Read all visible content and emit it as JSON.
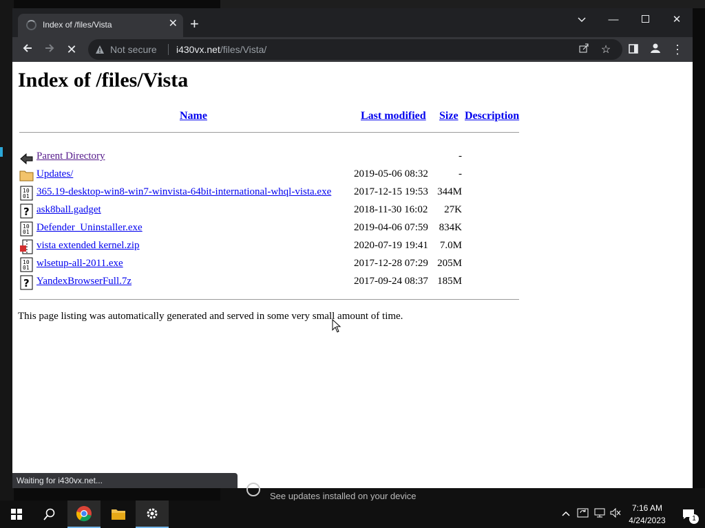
{
  "browser": {
    "tab_title": "Index of /files/Vista",
    "security_label": "Not secure",
    "url_host": "i430vx.net",
    "url_path": "/files/Vista/",
    "status_text": "Waiting for i430vx.net..."
  },
  "page": {
    "heading": "Index of /files/Vista",
    "columns": {
      "name": "Name",
      "last_modified": "Last modified",
      "size": "Size",
      "description": "Description"
    },
    "entries": [
      {
        "name": "Parent Directory",
        "date": "",
        "size": "-",
        "icon": "back-arrow-icon"
      },
      {
        "name": "Updates/",
        "date": "2019-05-06 08:32",
        "size": "-",
        "icon": "folder-icon"
      },
      {
        "name": "365.19-desktop-win8-win7-winvista-64bit-international-whql-vista.exe",
        "date": "2017-12-15 19:53",
        "size": "344M",
        "icon": "binary-file-icon"
      },
      {
        "name": "ask8ball.gadget",
        "date": "2018-11-30 16:02",
        "size": "27K",
        "icon": "unknown-file-icon"
      },
      {
        "name": "Defender_Uninstaller.exe",
        "date": "2019-04-06 07:59",
        "size": "834K",
        "icon": "binary-file-icon"
      },
      {
        "name": "vista extended kernel.zip",
        "date": "2020-07-19 19:41",
        "size": "7.0M",
        "icon": "compressed-file-icon"
      },
      {
        "name": "wlsetup-all-2011.exe",
        "date": "2017-12-28 07:29",
        "size": "205M",
        "icon": "binary-file-icon"
      },
      {
        "name": "YandexBrowserFull.7z",
        "date": "2017-09-24 08:37",
        "size": "185M",
        "icon": "unknown-file-icon"
      }
    ],
    "footer": "This page listing was automatically generated and served in some very small amount of time."
  },
  "notification": {
    "text": "See updates installed on your device"
  },
  "taskbar": {
    "time": "7:16 AM",
    "date": "4/24/2023",
    "notification_count": "1"
  }
}
